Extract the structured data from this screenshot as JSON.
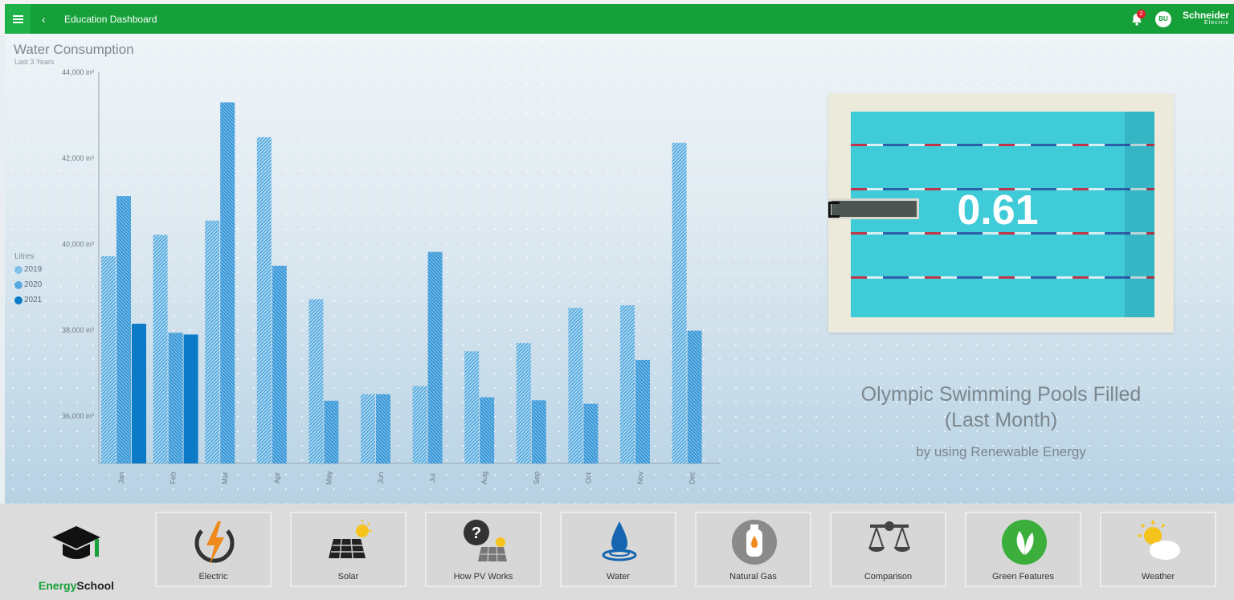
{
  "header": {
    "title": "Education Dashboard",
    "notification_count": "2",
    "user_initials": "BU",
    "brand_name": "Schneider",
    "brand_sub": "Electric",
    "accent_color": "#15a039"
  },
  "chart_data": {
    "type": "bar",
    "title": "Water Consumption",
    "subtitle": "Last 3 Years",
    "legend_title": "Litres",
    "legend_position": "left",
    "grid": false,
    "y_unit": "in³",
    "ylim": [
      34900,
      44000
    ],
    "yticks": [
      "36,000 in³",
      "38,000 in³",
      "40,000 in³",
      "42,000 in³",
      "44,000 in³"
    ],
    "categories": [
      "Jan",
      "Feb",
      "Mar",
      "Apr",
      "May",
      "Jun",
      "Jul",
      "Aug",
      "Sep",
      "Oct",
      "Nov",
      "Dec"
    ],
    "series": [
      {
        "name": "2019",
        "color": "#4aa4dc",
        "values": [
          39720,
          40220,
          40550,
          42490,
          38720,
          36510,
          36700,
          37510,
          37700,
          38520,
          38580,
          42360
        ]
      },
      {
        "name": "2020",
        "color": "#2a8fd4",
        "values": [
          41120,
          37940,
          43300,
          39500,
          36360,
          36510,
          39820,
          36440,
          36370,
          36290,
          37310,
          37990
        ]
      },
      {
        "name": "2021",
        "color": "#0b7bc8",
        "values": [
          38150,
          37900,
          null,
          null,
          null,
          null,
          null,
          null,
          null,
          null,
          null,
          null
        ]
      }
    ]
  },
  "pool": {
    "value": "0.61",
    "caption_line1": "Olympic Swimming Pools Filled",
    "caption_line2": "(Last Month)",
    "subcaption": "by using Renewable Energy"
  },
  "nav": {
    "logo_part1": "Energy",
    "logo_part2": "School",
    "tiles": [
      {
        "label": "Electric",
        "icon": "electric-bolt-icon"
      },
      {
        "label": "Solar",
        "icon": "solar-panel-icon"
      },
      {
        "label": "How PV Works",
        "icon": "pv-question-icon"
      },
      {
        "label": "Water",
        "icon": "water-drop-icon"
      },
      {
        "label": "Natural Gas",
        "icon": "gas-cylinder-icon"
      },
      {
        "label": "Comparison",
        "icon": "balance-scale-icon"
      },
      {
        "label": "Green Features",
        "icon": "leaf-icon"
      },
      {
        "label": "Weather",
        "icon": "sun-cloud-icon"
      }
    ]
  }
}
